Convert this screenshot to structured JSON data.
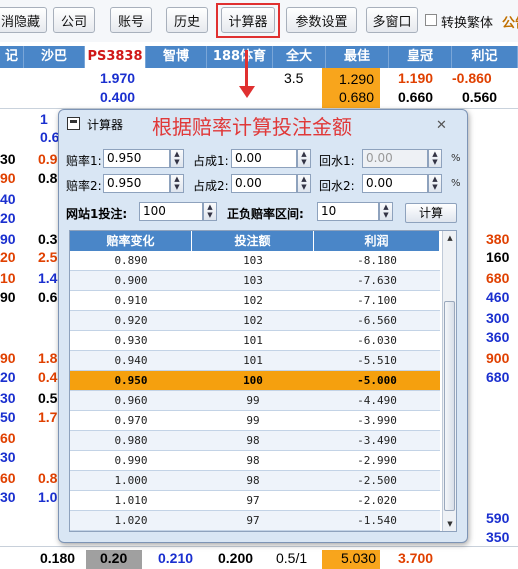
{
  "toolbar": {
    "hide_label": "消隐藏",
    "company_label": "公司",
    "account_label": "账号",
    "history_label": "历史",
    "calculator_label": "计算器",
    "settings_label": "参数设置",
    "multiwindow_label": "多窗口",
    "convert_label": "转换繁体",
    "edge_text": "公告"
  },
  "odds_header": [
    "记",
    "沙巴",
    "PS3838",
    "智博",
    "188体育",
    "全大",
    "最佳",
    "皇冠",
    "利记"
  ],
  "background_rows": {
    "row1": {
      "shaba_a": "1.970",
      "shaba_b": "0.400",
      "quanda": "3.5",
      "best_a": "1.290",
      "best_b": "0.680",
      "huangguan_a": "1.190",
      "huangguan_b": "0.660",
      "liji_a": "-0.860",
      "liji_b": "0.560"
    },
    "left_col": [
      "1",
      "0.6",
      "30",
      "90",
      "40",
      "20",
      "90",
      "20",
      "10",
      "90",
      "90",
      "20",
      "30",
      "50",
      "60",
      "30"
    ],
    "left_col2": [
      "0.9",
      "0.8",
      "0.3",
      "2.5",
      "1.4",
      "0.6",
      "1.8",
      "0.4",
      "0.5",
      "1.7",
      "0.8",
      "1.0"
    ],
    "right_col": [
      "380",
      "160",
      "680",
      "460",
      "300",
      "360",
      "900",
      "680",
      "590",
      "350"
    ],
    "bottom": {
      "v1": "0.180",
      "v2": "0.20",
      "v3": "0.210",
      "v4": "0.200",
      "v5": "0.5/1",
      "v6": "5.030",
      "v7": "3.700"
    }
  },
  "dialog": {
    "title": "计算器",
    "caption": "根据赔率计算投注金额",
    "close": "✕",
    "odds1_label": "赔率1:",
    "odds1_value": "0.950",
    "odds2_label": "赔率2:",
    "odds2_value": "0.950",
    "share1_label": "占成1:",
    "share1_value": "0.00",
    "share2_label": "占成2:",
    "share2_value": "0.00",
    "rebate1_label": "回水1:",
    "rebate1_value": "0.00",
    "rebate2_label": "回水2:",
    "rebate2_value": "0.00",
    "percent": "%",
    "stake_label": "网站1投注:",
    "stake_value": "100",
    "range_label": "正负赔率区间:",
    "range_value": "10",
    "calc_button": "计算"
  },
  "grid": {
    "headers": [
      "赔率变化",
      "投注额",
      "利润"
    ],
    "rows": [
      [
        "0.890",
        "103",
        "-8.180"
      ],
      [
        "0.900",
        "103",
        "-7.630"
      ],
      [
        "0.910",
        "102",
        "-7.100"
      ],
      [
        "0.920",
        "102",
        "-6.560"
      ],
      [
        "0.930",
        "101",
        "-6.030"
      ],
      [
        "0.940",
        "101",
        "-5.510"
      ],
      [
        "0.950",
        "100",
        "-5.000"
      ],
      [
        "0.960",
        "99",
        "-4.490"
      ],
      [
        "0.970",
        "99",
        "-3.990"
      ],
      [
        "0.980",
        "98",
        "-3.490"
      ],
      [
        "0.990",
        "98",
        "-2.990"
      ],
      [
        "1.000",
        "98",
        "-2.500"
      ],
      [
        "1.010",
        "97",
        "-2.020"
      ],
      [
        "1.020",
        "97",
        "-1.540"
      ]
    ],
    "selected_index": 6
  }
}
